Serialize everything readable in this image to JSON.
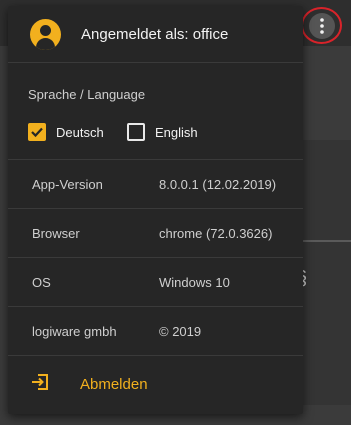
{
  "header": {
    "title": "Angemeldet als: office"
  },
  "language": {
    "title": "Sprache / Language",
    "options": [
      {
        "label": "Deutsch",
        "checked": true
      },
      {
        "label": "English",
        "checked": false
      }
    ]
  },
  "info": [
    {
      "key": "App-Version",
      "value": "8.0.0.1 (12.02.2019)"
    },
    {
      "key": "Browser",
      "value": "chrome (72.0.3626)"
    },
    {
      "key": "OS",
      "value": "Windows 10"
    },
    {
      "key": "logiware gmbh",
      "value": "© 2019"
    }
  ],
  "logout": {
    "label": "Abmelden"
  },
  "colors": {
    "accent": "#f2b01e",
    "panel": "#262626",
    "highlight_ring": "#d9232a"
  },
  "icons": {
    "menu": "more-vert-icon",
    "avatar": "account-circle-icon",
    "logout": "logout-icon"
  }
}
